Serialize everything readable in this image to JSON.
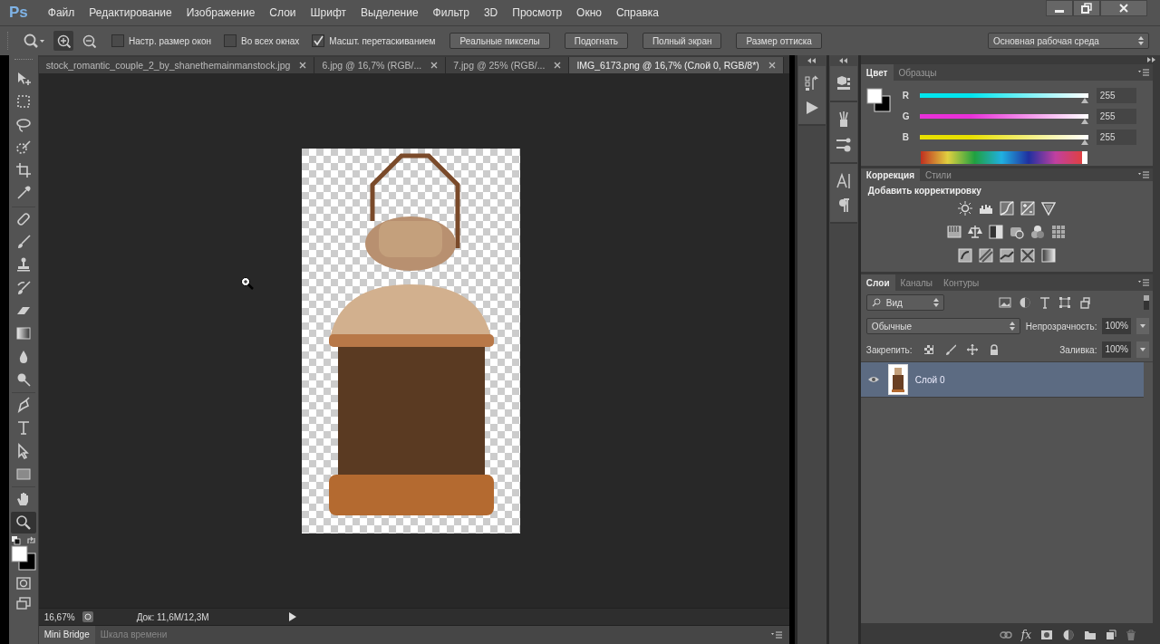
{
  "app_logo": "Ps",
  "menu": [
    "Файл",
    "Редактирование",
    "Изображение",
    "Слои",
    "Шрифт",
    "Выделение",
    "Фильтр",
    "3D",
    "Просмотр",
    "Окно",
    "Справка"
  ],
  "options_bar": {
    "zoom_modes": [
      {
        "kind": "zoom-in",
        "selected": true
      },
      {
        "kind": "zoom-out",
        "selected": false
      }
    ],
    "checkboxes": [
      {
        "label": "Настр. размер окон",
        "checked": false
      },
      {
        "label": "Во всех окнах",
        "checked": false
      },
      {
        "label": "Масшт. перетаскиванием",
        "checked": true
      }
    ],
    "buttons": [
      "Реальные пикселы",
      "Подогнать",
      "Полный экран",
      "Размер оттиска"
    ],
    "workspace": "Основная рабочая среда"
  },
  "document_tabs": [
    {
      "label": "stock_romantic_couple_2_by_shanethemainmanstock.jpg",
      "selected": false
    },
    {
      "label": "6.jpg @ 16,7% (RGB/...",
      "selected": false
    },
    {
      "label": "7.jpg @ 25% (RGB/...",
      "selected": false
    },
    {
      "label": "IMG_6173.png @ 16,7% (Слой 0, RGB/8*)",
      "selected": true
    }
  ],
  "tools": [
    {
      "kind": "move",
      "selected": false
    },
    {
      "kind": "marquee",
      "selected": false
    },
    {
      "kind": "lasso",
      "selected": false
    },
    {
      "kind": "quick-select",
      "selected": false
    },
    {
      "kind": "crop",
      "selected": false
    },
    {
      "kind": "eyedropper",
      "selected": false
    },
    {
      "kind": "bandage",
      "selected": false
    },
    {
      "kind": "brush",
      "selected": false
    },
    {
      "kind": "stamp",
      "selected": false
    },
    {
      "kind": "history-brush",
      "selected": false
    },
    {
      "kind": "eraser",
      "selected": false
    },
    {
      "kind": "gradient",
      "selected": false
    },
    {
      "kind": "drop",
      "selected": false
    },
    {
      "kind": "dodge",
      "selected": false
    },
    {
      "kind": "pen",
      "selected": false
    },
    {
      "kind": "type",
      "selected": false
    },
    {
      "kind": "pointer",
      "selected": false
    },
    {
      "kind": "rectangle",
      "selected": false
    },
    {
      "kind": "hand",
      "selected": false
    },
    {
      "kind": "zoom",
      "selected": true
    }
  ],
  "status_bar": {
    "zoom": "16,67%",
    "document": "Док: 11,6M/12,3M"
  },
  "bottom_tabs": [
    {
      "label": "Mini Bridge",
      "selected": true
    },
    {
      "label": "Шкала времени",
      "selected": false
    }
  ],
  "color_panel": {
    "tabs": [
      {
        "label": "Цвет",
        "selected": true
      },
      {
        "label": "Образцы",
        "selected": false
      }
    ],
    "channels": [
      {
        "name": "R",
        "color": "#00e5ee",
        "level": 1,
        "value": "255"
      },
      {
        "name": "G",
        "color": "#e830d8",
        "level": 1,
        "value": "255"
      },
      {
        "name": "B",
        "color": "#e8e000",
        "level": 1,
        "value": "255"
      }
    ]
  },
  "adjustments_panel": {
    "tabs": [
      {
        "label": "Коррекция",
        "selected": true
      },
      {
        "label": "Стили",
        "selected": false
      }
    ],
    "title": "Добавить корректировку"
  },
  "layers_panel": {
    "tabs": [
      {
        "label": "Слои",
        "selected": true
      },
      {
        "label": "Каналы",
        "selected": false
      },
      {
        "label": "Контуры",
        "selected": false
      }
    ],
    "filter": "Вид",
    "blend_mode": "Обычные",
    "opacity_label": "Непрозрачность:",
    "opacity": "100%",
    "lock_label": "Закрепить:",
    "fill_label": "Заливка:",
    "fill": "100%",
    "layers": [
      {
        "name": "Слой 0",
        "visible": true,
        "selected": true
      }
    ],
    "footer_fx": "fx"
  }
}
